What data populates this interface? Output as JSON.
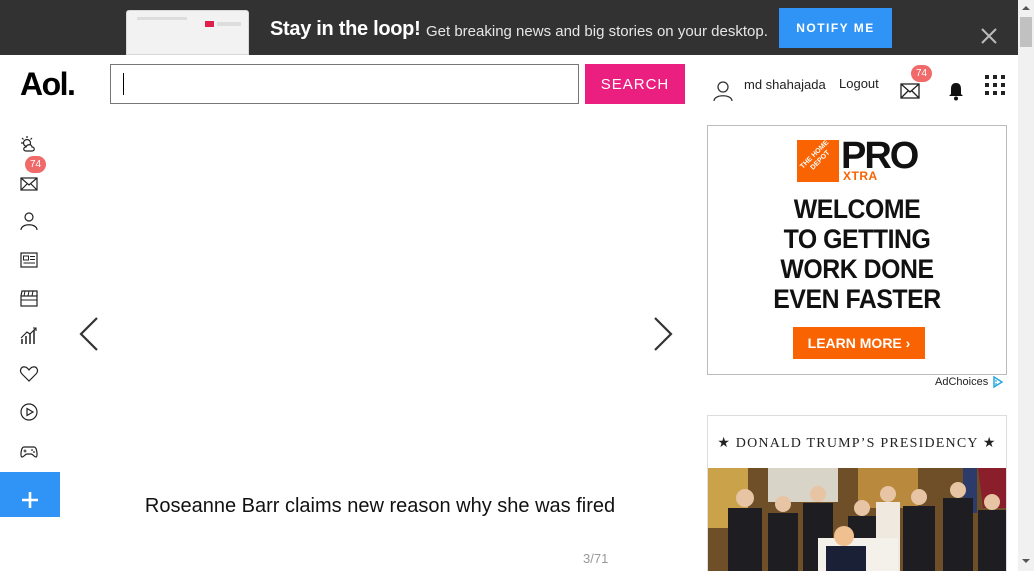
{
  "banner": {
    "title": "Stay in the loop!",
    "subtitle": "Get breaking news and big stories on your desktop.",
    "notify_label": "NOTIFY ME"
  },
  "header": {
    "logo": "Aol.",
    "search": {
      "value": "",
      "button_label": "SEARCH"
    },
    "username": "md shahajada",
    "logout_label": "Logout",
    "mail_count": "74"
  },
  "sidebar": {
    "items": [
      {
        "icon": "weather-icon"
      },
      {
        "icon": "mail-icon",
        "badge": "74"
      },
      {
        "icon": "user-icon"
      },
      {
        "icon": "news-icon"
      },
      {
        "icon": "entertainment-icon"
      },
      {
        "icon": "finance-icon"
      },
      {
        "icon": "lifestyle-icon"
      },
      {
        "icon": "video-icon"
      },
      {
        "icon": "games-icon"
      }
    ],
    "add_icon": "plus-icon"
  },
  "slideshow": {
    "caption": "Roseanne Barr claims new reason why she was fired",
    "counter": "3/71"
  },
  "ad": {
    "brand_logo_text": "THE HOME DEPOT",
    "pro": "PRO",
    "xtra": "XTRA",
    "headline": [
      "WELCOME",
      "TO GETTING",
      "WORK DONE",
      "EVEN FASTER"
    ],
    "cta": "LEARN MORE",
    "adchoices": "AdChoices"
  },
  "card": {
    "title": "★ DONALD TRUMP’S PRESIDENCY ★"
  },
  "colors": {
    "banner_bg": "#323232",
    "notify_blue": "#2f94f5",
    "search_pink": "#ea1f7f",
    "home_depot_orange": "#f96302",
    "badge_red": "#f06a6a"
  }
}
